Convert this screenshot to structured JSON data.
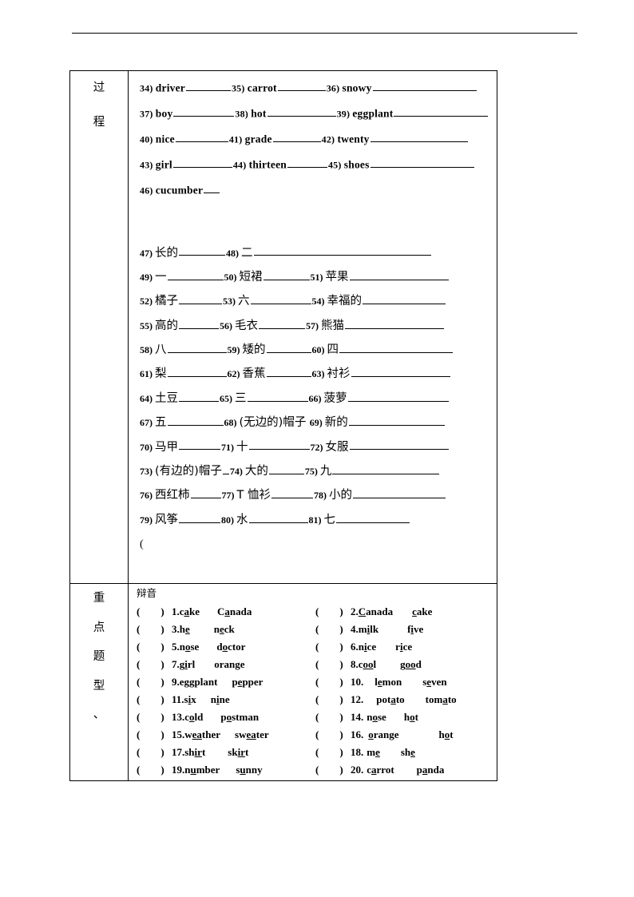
{
  "document": {
    "header_rule": true,
    "row_labels": {
      "process": [
        "过",
        "程"
      ],
      "key_question_types": [
        "重",
        "点",
        "题",
        "型",
        "、"
      ]
    }
  },
  "english_translation_items": [
    [
      {
        "num": "34)",
        "word": "driver",
        "blank": 56
      },
      {
        "num": "35)",
        "word": "carrot",
        "blank": 60
      },
      {
        "num": "36)",
        "word": "snowy",
        "blank": 130
      }
    ],
    [
      {
        "num": "37)",
        "word": "boy",
        "blank": 76
      },
      {
        "num": "38)",
        "word": "hot",
        "blank": 86
      },
      {
        "num": "39)",
        "word": "eggplant",
        "blank": 118
      }
    ],
    [
      {
        "num": "40)",
        "word": "nice",
        "blank": 66
      },
      {
        "num": "41)",
        "word": "grade",
        "blank": 60
      },
      {
        "num": "42)",
        "word": "twenty",
        "blank": 122
      }
    ],
    [
      {
        "num": "43)",
        "word": "girl",
        "blank": 74
      },
      {
        "num": "44)",
        "word": "thirteen",
        "blank": 50
      },
      {
        "num": "45)",
        "word": "shoes",
        "blank": 130
      }
    ],
    [
      {
        "num": "46)",
        "word": "cucumber",
        "blank": 20
      }
    ]
  ],
  "chinese_translation_items": [
    [
      {
        "num": "47)",
        "word": "长的",
        "blank": 58
      },
      {
        "num": "48)",
        "word": "二",
        "blank": 222
      }
    ],
    [
      {
        "num": "49)",
        "word": "一",
        "blank": 70
      },
      {
        "num": "50)",
        "word": "短裙",
        "blank": 58
      },
      {
        "num": "51)",
        "word": "苹果",
        "blank": 124
      }
    ],
    [
      {
        "num": "52)",
        "word": "橘子",
        "blank": 54
      },
      {
        "num": "53)",
        "word": "六",
        "blank": 76
      },
      {
        "num": "54)",
        "word": "幸福的",
        "blank": 104
      }
    ],
    [
      {
        "num": "55)",
        "word": "高的",
        "blank": 50
      },
      {
        "num": "56)",
        "word": "毛衣",
        "blank": 58
      },
      {
        "num": "57)",
        "word": "熊猫",
        "blank": 124
      }
    ],
    [
      {
        "num": "58)",
        "word": "八",
        "blank": 74
      },
      {
        "num": "59)",
        "word": "矮的",
        "blank": 56
      },
      {
        "num": "60)",
        "word": "四",
        "blank": 142
      }
    ],
    [
      {
        "num": "61)",
        "word": "梨",
        "blank": 74
      },
      {
        "num": "62)",
        "word": "香蕉",
        "blank": 56
      },
      {
        "num": "63)",
        "word": "衬衫",
        "blank": 124
      }
    ],
    [
      {
        "num": "64)",
        "word": "土豆",
        "blank": 50
      },
      {
        "num": "65)",
        "word": "三",
        "blank": 76
      },
      {
        "num": "66)",
        "word": "菠萝",
        "blank": 126
      }
    ],
    [
      {
        "num": "67)",
        "word": "五",
        "blank": 70
      },
      {
        "num": "68)",
        "word": "(无边的)帽子",
        "blank": 0
      },
      {
        "num": "69)",
        "word": "新的",
        "blank": 120
      }
    ],
    [
      {
        "num": "70)",
        "word": "马甲",
        "blank": 52
      },
      {
        "num": "71)",
        "word": "十",
        "blank": 76
      },
      {
        "num": "72)",
        "word": "女服",
        "blank": 124
      }
    ],
    [
      {
        "num": "73)",
        "word": "(有边的)帽子",
        "blank": 8
      },
      {
        "num": "74)",
        "word": "大的",
        "blank": 44
      },
      {
        "num": "75)",
        "word": "九",
        "blank": 134
      }
    ],
    [
      {
        "num": "76)",
        "word": "西红柿",
        "blank": 38
      },
      {
        "num": "77)",
        "word": "T 恤衫",
        "blank": 52
      },
      {
        "num": "78)",
        "word": "小的",
        "blank": 116
      }
    ],
    [
      {
        "num": "79)",
        "word": "风筝",
        "blank": 52
      },
      {
        "num": "80)",
        "word": "水",
        "blank": 74
      },
      {
        "num": "81)",
        "word": "七",
        "blank": 92
      }
    ]
  ],
  "stray_paren": "(",
  "phonetics": {
    "title": "辩音",
    "paren_open": "(",
    "paren_close": ")",
    "rows": [
      [
        {
          "index": "1.",
          "w1": [
            [
              "c",
              0
            ],
            [
              "a",
              1
            ],
            [
              "ke",
              0
            ]
          ],
          "w2": [
            [
              "C",
              0
            ],
            [
              "a",
              1
            ],
            [
              "nada",
              0
            ]
          ],
          "pad": 0,
          "gap": 22
        },
        {
          "index": "2.",
          "w1": [
            [
              "C",
              1
            ],
            [
              "anada",
              0
            ]
          ],
          "w2": [
            [
              "c",
              1
            ],
            [
              "ake",
              0
            ]
          ],
          "pad": 0,
          "gap": 24
        }
      ],
      [
        {
          "index": "3.",
          "w1": [
            [
              "h",
              0
            ],
            [
              "e",
              1
            ]
          ],
          "w2": [
            [
              "n",
              0
            ],
            [
              "e",
              1
            ],
            [
              "ck",
              0
            ]
          ],
          "pad": 0,
          "gap": 30
        },
        {
          "index": "4.",
          "w1": [
            [
              "m",
              0
            ],
            [
              "i",
              1
            ],
            [
              "lk",
              0
            ]
          ],
          "w2": [
            [
              "f",
              0
            ],
            [
              "i",
              1
            ],
            [
              "ve",
              0
            ]
          ],
          "pad": 0,
          "gap": 36
        }
      ],
      [
        {
          "index": "5.",
          "w1": [
            [
              "n",
              0
            ],
            [
              "o",
              1
            ],
            [
              "se",
              0
            ]
          ],
          "w2": [
            [
              "d",
              0
            ],
            [
              "o",
              1
            ],
            [
              "ctor",
              0
            ]
          ],
          "pad": 0,
          "gap": 22
        },
        {
          "index": "6.",
          "w1": [
            [
              "n",
              0
            ],
            [
              "i",
              1
            ],
            [
              "ce",
              0
            ]
          ],
          "w2": [
            [
              "r",
              0
            ],
            [
              "i",
              1
            ],
            [
              "ce",
              0
            ]
          ],
          "pad": 0,
          "gap": 24
        }
      ],
      [
        {
          "index": "7.",
          "w1": [
            [
              "g",
              0
            ],
            [
              "i",
              1
            ],
            [
              "rl",
              0
            ]
          ],
          "w2": [
            [
              "oran",
              0
            ],
            [
              "g",
              1
            ],
            [
              "e",
              0
            ]
          ],
          "pad": 0,
          "gap": 24
        },
        {
          "index": "8.",
          "w1": [
            [
              "c",
              0
            ],
            [
              "oo",
              1
            ],
            [
              "l",
              0
            ]
          ],
          "w2": [
            [
              "g",
              0
            ],
            [
              "oo",
              1
            ],
            [
              "d",
              0
            ]
          ],
          "pad": 0,
          "gap": 30
        }
      ],
      [
        {
          "index": "9.",
          "w1": [
            [
              "e",
              0
            ],
            [
              "gg",
              1
            ],
            [
              "plant",
              0
            ]
          ],
          "w2": [
            [
              "p",
              0
            ],
            [
              "e",
              1
            ],
            [
              "pper",
              0
            ]
          ],
          "pad": 0,
          "gap": 18
        },
        {
          "index": "10.",
          "w1": [
            [
              "l",
              0
            ],
            [
              "e",
              1
            ],
            [
              "mon",
              0
            ]
          ],
          "w2": [
            [
              "s",
              0
            ],
            [
              "e",
              1
            ],
            [
              "ven",
              0
            ]
          ],
          "pad": 14,
          "gap": 26
        }
      ],
      [
        {
          "index": "11.",
          "w1": [
            [
              "s",
              0
            ],
            [
              "i",
              1
            ],
            [
              "x",
              0
            ]
          ],
          "w2": [
            [
              "n",
              0
            ],
            [
              "i",
              1
            ],
            [
              "ne",
              0
            ]
          ],
          "pad": 0,
          "gap": 18
        },
        {
          "index": "12.",
          "w1": [
            [
              "pot",
              0
            ],
            [
              "a",
              1
            ],
            [
              "to",
              0
            ]
          ],
          "w2": [
            [
              "tom",
              0
            ],
            [
              "a",
              1
            ],
            [
              "to",
              0
            ]
          ],
          "pad": 16,
          "gap": 26
        }
      ],
      [
        {
          "index": "13.",
          "w1": [
            [
              "c",
              0
            ],
            [
              "o",
              1
            ],
            [
              "ld",
              0
            ]
          ],
          "w2": [
            [
              "p",
              0
            ],
            [
              "o",
              1
            ],
            [
              "stman",
              0
            ]
          ],
          "pad": 0,
          "gap": 22
        },
        {
          "index": "14.",
          "w1": [
            [
              "n",
              0
            ],
            [
              "o",
              1
            ],
            [
              "se",
              0
            ]
          ],
          "w2": [
            [
              "h",
              0
            ],
            [
              "o",
              1
            ],
            [
              "t",
              0
            ]
          ],
          "pad": 4,
          "gap": 22
        }
      ],
      [
        {
          "index": "15.",
          "w1": [
            [
              "w",
              0
            ],
            [
              "ea",
              1
            ],
            [
              "ther",
              0
            ]
          ],
          "w2": [
            [
              "sw",
              0
            ],
            [
              "ea",
              1
            ],
            [
              "ter",
              0
            ]
          ],
          "pad": 0,
          "gap": 18
        },
        {
          "index": "16.",
          "w1": [
            [
              "o",
              1
            ],
            [
              "range",
              0
            ]
          ],
          "w2": [
            [
              "h",
              0
            ],
            [
              "o",
              1
            ],
            [
              "t",
              0
            ]
          ],
          "pad": 6,
          "gap": 50
        }
      ],
      [
        {
          "index": "17.",
          "w1": [
            [
              "sh",
              0
            ],
            [
              "ir",
              1
            ],
            [
              "t",
              0
            ]
          ],
          "w2": [
            [
              "sk",
              0
            ],
            [
              "ir",
              1
            ],
            [
              "t",
              0
            ]
          ],
          "pad": 0,
          "gap": 28
        },
        {
          "index": "18.",
          "w1": [
            [
              "m",
              0
            ],
            [
              "e",
              1
            ]
          ],
          "w2": [
            [
              "sh",
              0
            ],
            [
              "e",
              1
            ]
          ],
          "pad": 4,
          "gap": 26
        }
      ],
      [
        {
          "index": "19.",
          "w1": [
            [
              "n",
              0
            ],
            [
              "u",
              1
            ],
            [
              "mber",
              0
            ]
          ],
          "w2": [
            [
              "s",
              0
            ],
            [
              "u",
              1
            ],
            [
              "nny",
              0
            ]
          ],
          "pad": 0,
          "gap": 20
        },
        {
          "index": "20.",
          "w1": [
            [
              "c",
              0
            ],
            [
              "a",
              1
            ],
            [
              "rrot",
              0
            ]
          ],
          "w2": [
            [
              "p",
              0
            ],
            [
              "a",
              1
            ],
            [
              "nda",
              0
            ]
          ],
          "pad": 4,
          "gap": 28
        }
      ]
    ]
  }
}
